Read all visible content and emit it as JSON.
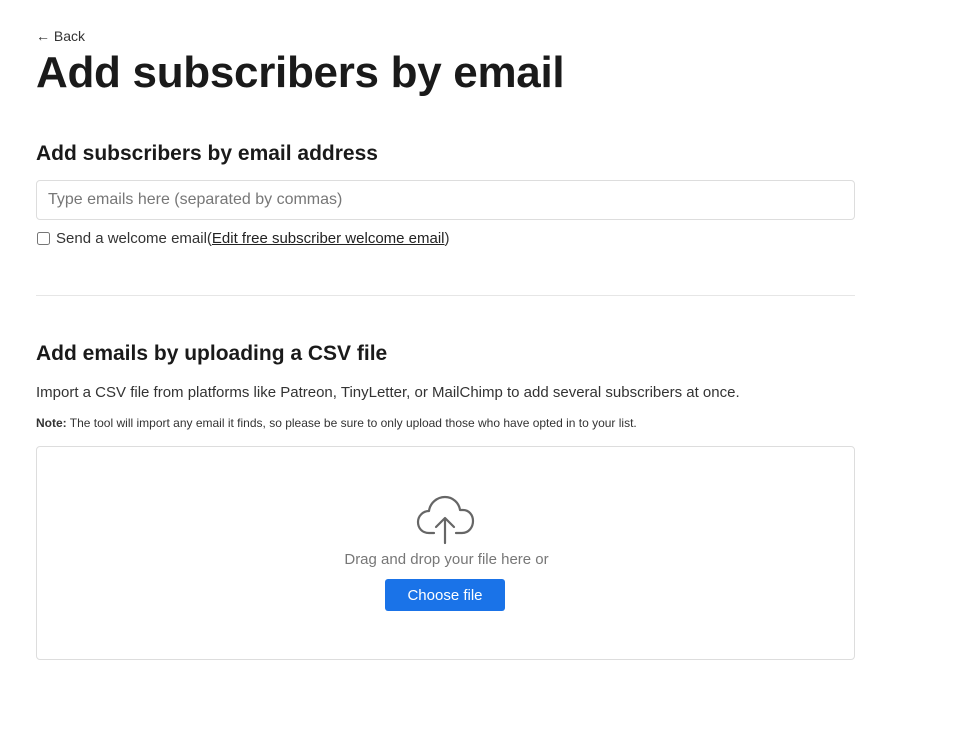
{
  "nav": {
    "back_label": "← Back"
  },
  "page": {
    "title": "Add subscribers by email"
  },
  "email_section": {
    "heading": "Add subscribers by email address",
    "input_placeholder": "Type emails here (separated by commas)",
    "input_value": "",
    "welcome_checkbox_checked": false,
    "welcome_label": "Send a welcome email",
    "welcome_paren_open": " (",
    "welcome_link": "Edit free subscriber welcome email",
    "welcome_paren_close": ")"
  },
  "csv_section": {
    "heading": "Add emails by uploading a CSV file",
    "description": "Import a CSV file from platforms like Patreon, TinyLetter, or MailChimp to add several subscribers at once.",
    "note_label": "Note:",
    "note_text": " The tool will import any email it finds, so please be sure to only upload those who have opted in to your list.",
    "dropzone_icon": "cloud-upload-icon",
    "dropzone_text": "Drag and drop your file here or",
    "choose_file_label": "Choose file"
  },
  "colors": {
    "accent": "#1a73e8",
    "border": "#dddddd",
    "muted_text": "#777777"
  }
}
